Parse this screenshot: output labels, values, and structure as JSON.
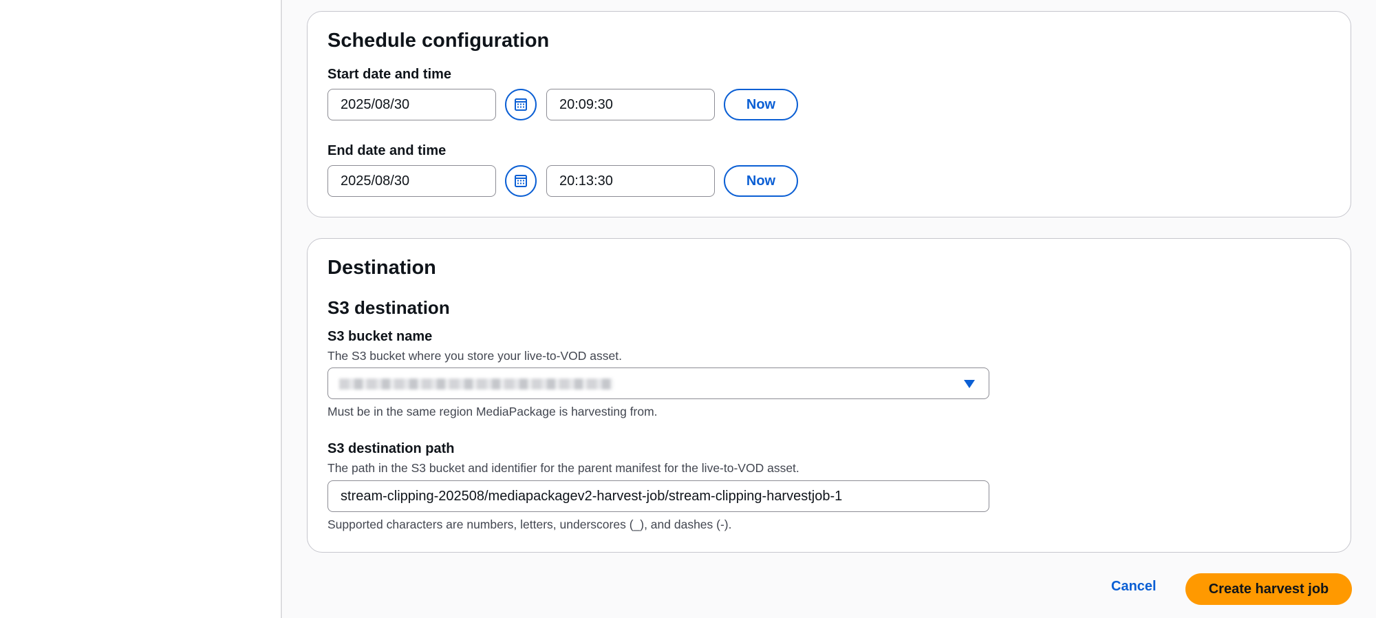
{
  "schedule": {
    "title": "Schedule configuration",
    "start": {
      "label": "Start date and time",
      "date": "2025/08/30",
      "time": "20:09:30",
      "now_label": "Now"
    },
    "end": {
      "label": "End date and time",
      "date": "2025/08/30",
      "time": "20:13:30",
      "now_label": "Now"
    }
  },
  "destination": {
    "title": "Destination",
    "s3_title": "S3 destination",
    "bucket": {
      "label": "S3 bucket name",
      "description": "The S3 bucket where you store your live-to-VOD asset.",
      "hint": "Must be in the same region MediaPackage is harvesting from."
    },
    "path": {
      "label": "S3 destination path",
      "description": "The path in the S3 bucket and identifier for the parent manifest for the live-to-VOD asset.",
      "value": "stream-clipping-202508/mediapackagev2-harvest-job/stream-clipping-harvestjob-1",
      "hint": "Supported characters are numbers, letters, underscores (_), and dashes (-)."
    }
  },
  "actions": {
    "cancel_label": "Cancel",
    "create_label": "Create harvest job"
  },
  "icons": {
    "calendar": "calendar-icon",
    "caret": "caret-down-icon"
  },
  "colors": {
    "accent": "#0b5fd4",
    "primary_button": "#ff9900"
  }
}
